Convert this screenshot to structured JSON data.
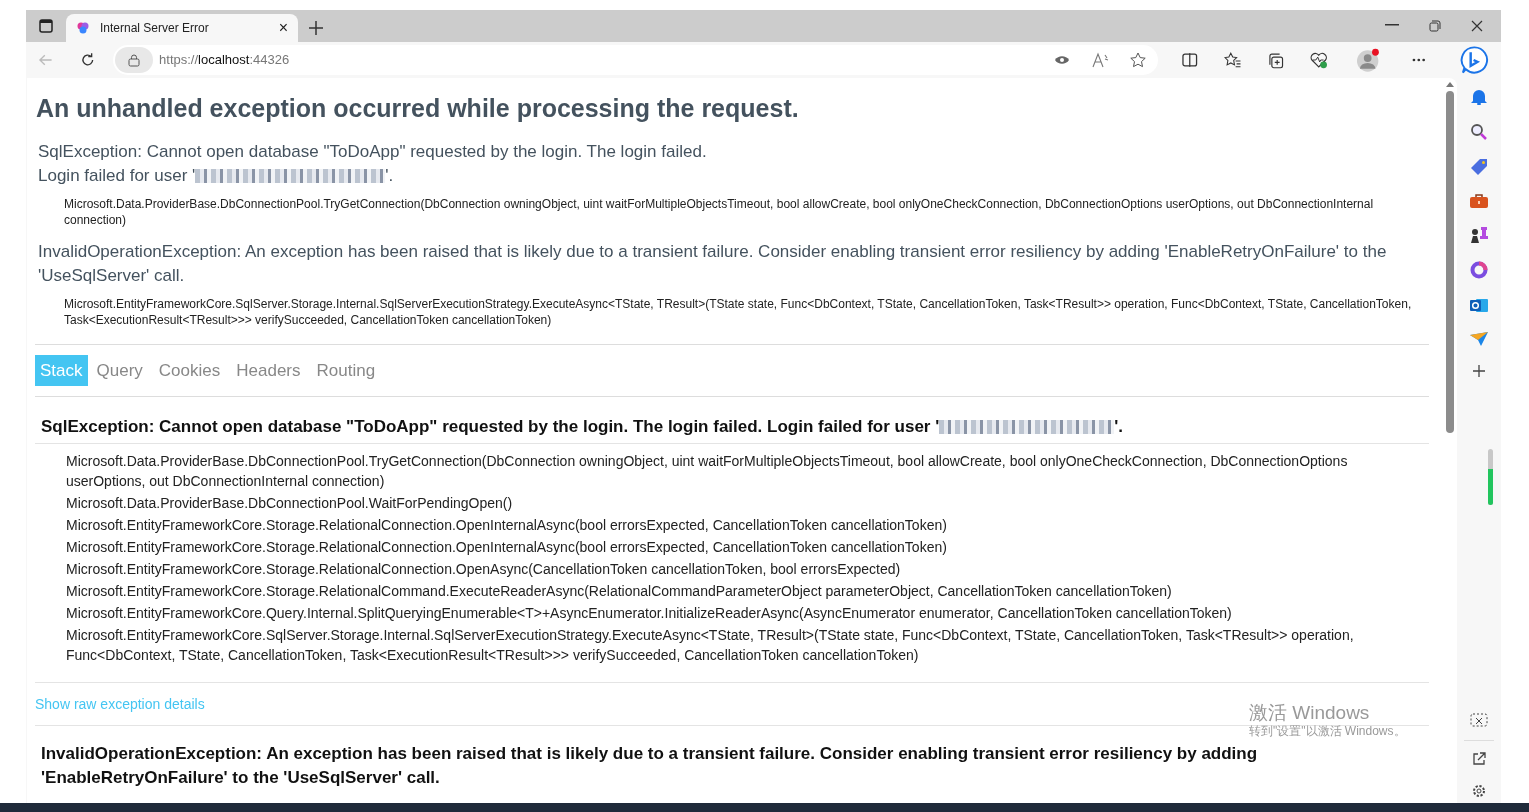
{
  "browser": {
    "tab_title": "Internal Server Error",
    "tab_close": "×",
    "url_scheme": "https://",
    "url_host": "localhost",
    "url_port": ":44326"
  },
  "heading": "An unhandled exception occurred while processing the request.",
  "summary": [
    {
      "kind": "redacted",
      "message": "SqlException: Cannot open database \"ToDoApp\" requested by the login. The login failed.",
      "before": "Login failed for user '",
      "after": "'.",
      "frame": "Microsoft.Data.ProviderBase.DbConnectionPool.TryGetConnection(DbConnection owningObject, uint waitForMultipleObjectsTimeout, bool allowCreate, bool onlyOneCheckConnection, DbConnectionOptions userOptions, out DbConnectionInternal connection)"
    },
    {
      "kind": "plain",
      "message": "InvalidOperationException: An exception has been raised that is likely due to a transient failure. Consider enabling transient error resiliency by adding 'EnableRetryOnFailure' to the 'UseSqlServer' call.",
      "frame": "Microsoft.EntityFrameworkCore.SqlServer.Storage.Internal.SqlServerExecutionStrategy.ExecuteAsync<TState, TResult>(TState state, Func<DbContext, TState, CancellationToken, Task<TResult>> operation, Func<DbContext, TState, CancellationToken, Task<ExecutionResult<TResult>>> verifySucceeded, CancellationToken cancellationToken)"
    }
  ],
  "tabs": [
    {
      "label": "Stack",
      "selected": true
    },
    {
      "label": "Query",
      "selected": false
    },
    {
      "label": "Cookies",
      "selected": false
    },
    {
      "label": "Headers",
      "selected": false
    },
    {
      "label": "Routing",
      "selected": false
    }
  ],
  "stack": [
    {
      "kind": "redacted",
      "before": "SqlException: Cannot open database \"ToDoApp\" requested by the login. The login failed. Login failed for user '",
      "after": "'.",
      "frames": [
        "Microsoft.Data.ProviderBase.DbConnectionPool.TryGetConnection(DbConnection owningObject, uint waitForMultipleObjectsTimeout, bool allowCreate, bool onlyOneCheckConnection, DbConnectionOptions userOptions, out DbConnectionInternal connection)",
        "Microsoft.Data.ProviderBase.DbConnectionPool.WaitForPendingOpen()",
        "Microsoft.EntityFrameworkCore.Storage.RelationalConnection.OpenInternalAsync(bool errorsExpected, CancellationToken cancellationToken)",
        "Microsoft.EntityFrameworkCore.Storage.RelationalConnection.OpenInternalAsync(bool errorsExpected, CancellationToken cancellationToken)",
        "Microsoft.EntityFrameworkCore.Storage.RelationalConnection.OpenAsync(CancellationToken cancellationToken, bool errorsExpected)",
        "Microsoft.EntityFrameworkCore.Storage.RelationalCommand.ExecuteReaderAsync(RelationalCommandParameterObject parameterObject, CancellationToken cancellationToken)",
        "Microsoft.EntityFrameworkCore.Query.Internal.SplitQueryingEnumerable<T>+AsyncEnumerator.InitializeReaderAsync(AsyncEnumerator enumerator, CancellationToken cancellationToken)",
        "Microsoft.EntityFrameworkCore.SqlServer.Storage.Internal.SqlServerExecutionStrategy.ExecuteAsync<TState, TResult>(TState state, Func<DbContext, TState, CancellationToken, Task<TResult>> operation, Func<DbContext, TState, CancellationToken, Task<ExecutionResult<TResult>>> verifySucceeded, CancellationToken cancellationToken)"
      ],
      "raw_link": "Show raw exception details"
    },
    {
      "kind": "plain",
      "before": "InvalidOperationException: An exception has been raised that is likely due to a transient failure. Consider enabling transient error resiliency by adding 'EnableRetryOnFailure' to the 'UseSqlServer' call."
    }
  ],
  "activation": {
    "title": "激活 Windows",
    "hint": "转到\"设置\"以激活 Windows。"
  }
}
